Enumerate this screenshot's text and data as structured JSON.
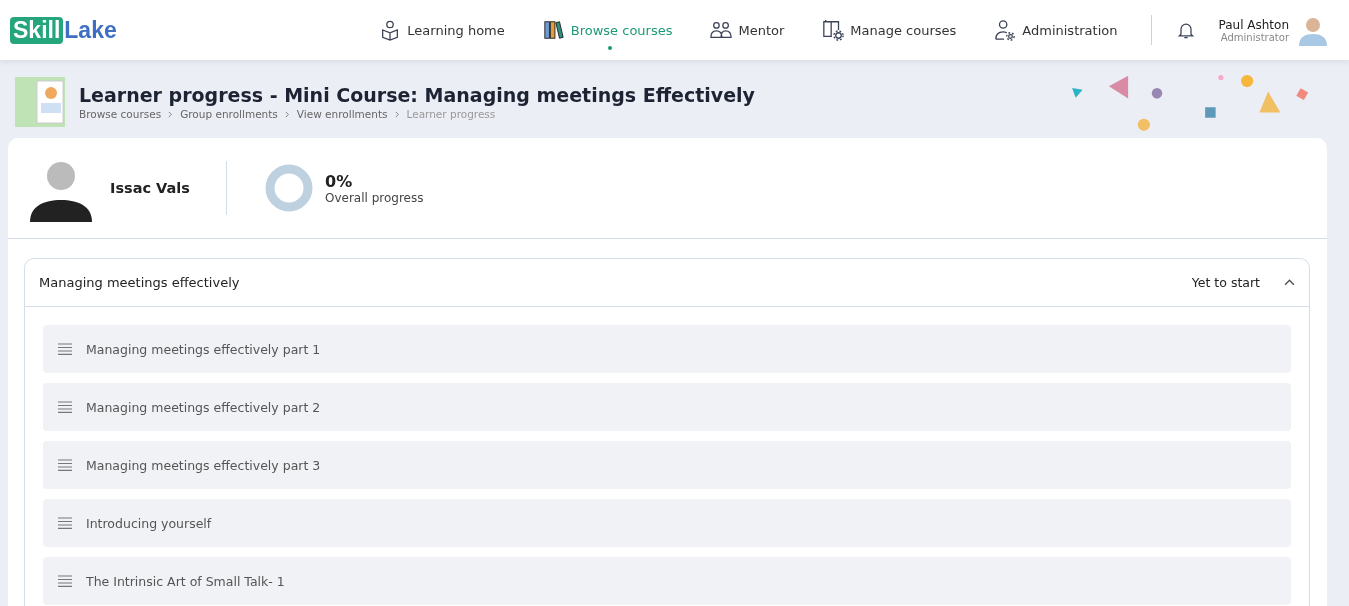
{
  "logo": {
    "highlight": "Skill",
    "rest": "Lake"
  },
  "nav": [
    {
      "label": "Learning home",
      "kind": "reader",
      "selected": false
    },
    {
      "label": "Browse courses",
      "kind": "books",
      "selected": true
    },
    {
      "label": "Mentor",
      "kind": "people",
      "selected": false
    },
    {
      "label": "Manage courses",
      "kind": "book-gear",
      "selected": false
    },
    {
      "label": "Administration",
      "kind": "user-gear",
      "selected": false
    }
  ],
  "user": {
    "name": "Paul Ashton",
    "role": "Administrator"
  },
  "page": {
    "title": "Learner progress - Mini Course: Managing meetings Effectively",
    "breadcrumbs": [
      {
        "label": "Browse courses",
        "current": false
      },
      {
        "label": "Group enrollments",
        "current": false
      },
      {
        "label": "View enrollments",
        "current": false
      },
      {
        "label": "Learner progress",
        "current": true
      }
    ]
  },
  "learner": {
    "name": "Issac Vals"
  },
  "progress": {
    "level": 0,
    "percent": "0%",
    "label": "Overall progress"
  },
  "section": {
    "title": "Managing meetings effectively",
    "status": "Yet to start",
    "expanded": true,
    "lessons": [
      "Managing meetings effectively part 1",
      "Managing meetings effectively part 2",
      "Managing meetings effectively part 3",
      "Introducing yourself",
      "The Intrinsic Art of Small Talk- 1"
    ]
  }
}
